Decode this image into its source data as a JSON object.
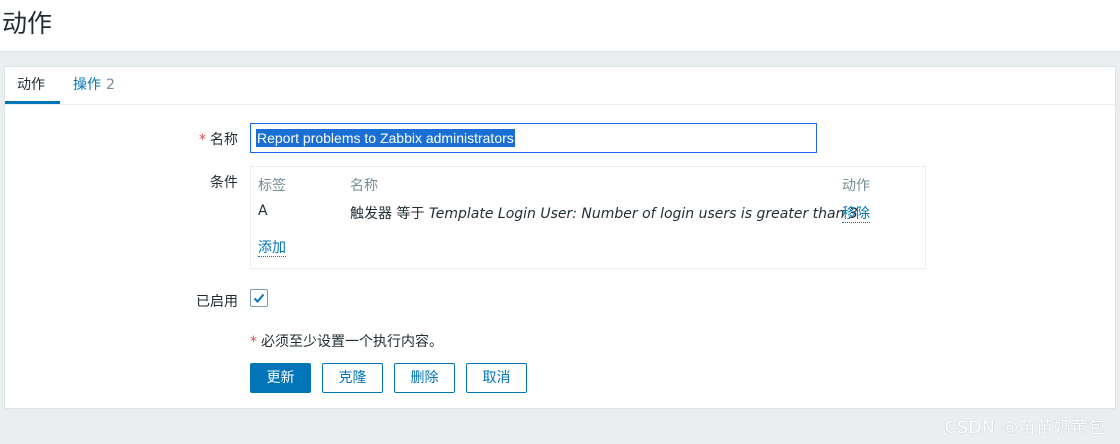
{
  "header": {
    "title": "动作"
  },
  "tabs": [
    {
      "label": "动作"
    },
    {
      "label": "操作",
      "count": "2"
    }
  ],
  "form": {
    "name_label": "名称",
    "required_mark": "*",
    "name_value": "Report problems to Zabbix administrators",
    "conditions_label": "条件",
    "conditions": {
      "headers": {
        "tag": "标签",
        "name": "名称",
        "action": "动作"
      },
      "rows": [
        {
          "tag": "A",
          "prefix": "触发器 等于",
          "value": "Template Login User: Number of login users is greater than 3",
          "action": "移除"
        }
      ],
      "add_label": "添加"
    },
    "enabled_label": "已启用",
    "enabled": true,
    "note": "必须至少设置一个执行内容。"
  },
  "buttons": {
    "update": "更新",
    "clone": "克隆",
    "delete": "删除",
    "cancel": "取消"
  },
  "watermark": "CSDN @苗苗奶黄包.",
  "colors": {
    "accent": "#0275b8",
    "required": "#d64e4e",
    "background": "#ebeef0"
  }
}
